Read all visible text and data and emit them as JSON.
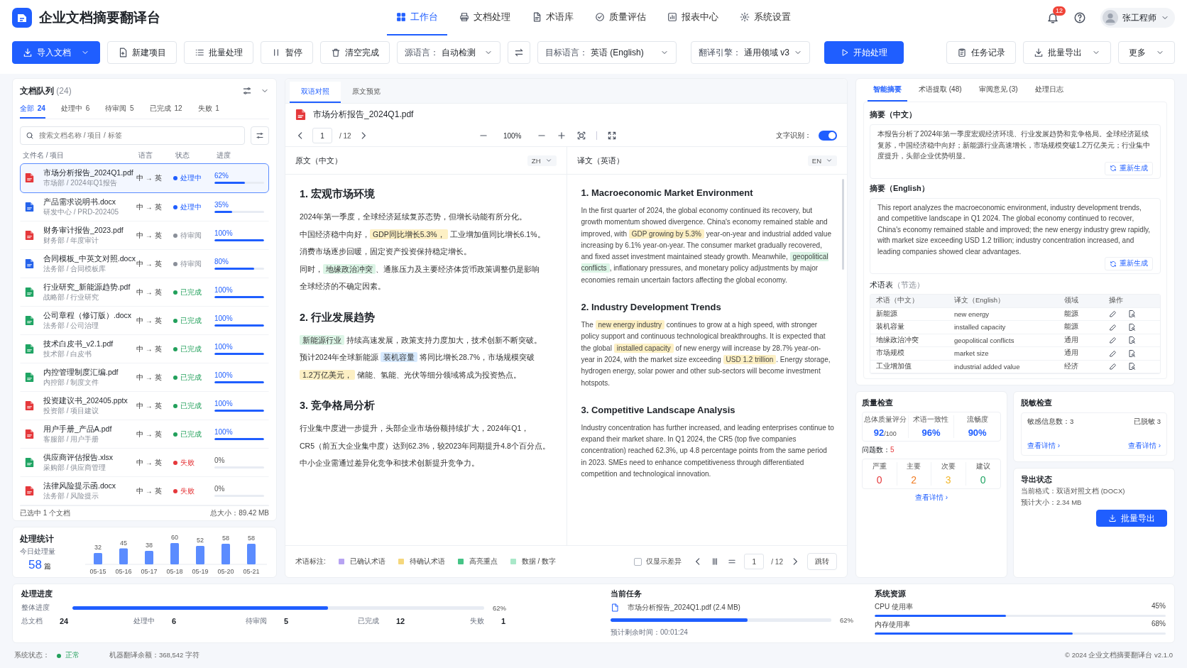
{
  "app": {
    "title": "企业文档摘要翻译台"
  },
  "nav": [
    {
      "label": "工作台",
      "selected": true
    },
    {
      "label": "文档处理",
      "selected": false
    },
    {
      "label": "术语库",
      "selected": false
    },
    {
      "label": "质量评估",
      "selected": false
    },
    {
      "label": "报表中心",
      "selected": false
    },
    {
      "label": "系统设置",
      "selected": false
    }
  ],
  "notifications": {
    "count": "12"
  },
  "user": {
    "name": "张工程师"
  },
  "toolbar": {
    "actions": [
      {
        "label": "导入文档",
        "kind": "primary",
        "dropdown": true
      },
      {
        "label": "新建项目",
        "kind": "plain",
        "dropdown": false
      },
      {
        "label": "批量处理",
        "kind": "plain",
        "dropdown": false
      },
      {
        "label": "暂停",
        "kind": "plain",
        "dropdown": false
      },
      {
        "label": "清空完成",
        "kind": "plain",
        "dropdown": false
      }
    ],
    "selects": [
      {
        "label": "源语言：",
        "value": "自动检测"
      },
      {
        "label": "目标语言：",
        "value": "英语 (English)"
      },
      {
        "label": "翻译引擎：",
        "value": "通用领域 v3"
      }
    ],
    "start": "开始处理",
    "right": [
      {
        "label": "任务记录",
        "kind": "plain",
        "dropdown": false
      },
      {
        "label": "批量导出",
        "kind": "plain",
        "dropdown": true
      },
      {
        "label": "更多",
        "kind": "plain",
        "dropdown": true
      }
    ]
  },
  "queue": {
    "title": "文档队列",
    "count": "(24)",
    "filters": [
      {
        "label": "全部",
        "count": "24",
        "selected": true
      },
      {
        "label": "处理中",
        "count": "6",
        "selected": false
      },
      {
        "label": "待审阅",
        "count": "5",
        "selected": false
      },
      {
        "label": "已完成",
        "count": "12",
        "selected": false
      },
      {
        "label": "失败",
        "count": "1",
        "selected": false
      }
    ],
    "search_placeholder": "搜索文档名称 / 项目 / 标签",
    "columns": [
      "文件名 / 项目",
      "语言",
      "状态",
      "进度"
    ],
    "docs": [
      {
        "name": "市场分析报告_2024Q1.pdf",
        "meta": "市场部 / 2024年Q1报告",
        "color": "#e5383b",
        "lang": "中 → 英",
        "kind": "processing",
        "status_label": "处理中",
        "progress": "62%",
        "level": 0.62,
        "selected": true
      },
      {
        "name": "产品需求说明书.docx",
        "meta": "研发中心 / PRD-202405",
        "color": "#2563eb",
        "lang": "中 → 英",
        "kind": "processing",
        "status_label": "处理中",
        "progress": "35%",
        "level": 0.35,
        "selected": false
      },
      {
        "name": "财务审计报告_2023.pdf",
        "meta": "财务部 / 年度审计",
        "color": "#e5383b",
        "lang": "中 → 英",
        "kind": "pending",
        "status_label": "待审阅",
        "progress": "100%",
        "level": 1,
        "selected": false
      },
      {
        "name": "合同模板_中英文对照.docx",
        "meta": "法务部 / 合同模板库",
        "color": "#2563eb",
        "lang": "中 → 英",
        "kind": "pending",
        "status_label": "待审阅",
        "progress": "80%",
        "level": 0.8,
        "selected": false
      },
      {
        "name": "行业研究_新能源趋势.pdf",
        "meta": "战略部 / 行业研究",
        "color": "#1fa463",
        "lang": "中 → 英",
        "kind": "done",
        "status_label": "已完成",
        "progress": "100%",
        "level": 1,
        "selected": false
      },
      {
        "name": "公司章程（修订版）.docx",
        "meta": "法务部 / 公司治理",
        "color": "#1fa463",
        "lang": "中 → 英",
        "kind": "done",
        "status_label": "已完成",
        "progress": "100%",
        "level": 1,
        "selected": false
      },
      {
        "name": "技术白皮书_v2.1.pdf",
        "meta": "技术部 / 白皮书",
        "color": "#1fa463",
        "lang": "中 → 英",
        "kind": "done",
        "status_label": "已完成",
        "progress": "100%",
        "level": 1,
        "selected": false
      },
      {
        "name": "内控管理制度汇编.pdf",
        "meta": "内控部 / 制度文件",
        "color": "#1fa463",
        "lang": "中 → 英",
        "kind": "done",
        "status_label": "已完成",
        "progress": "100%",
        "level": 1,
        "selected": false
      },
      {
        "name": "投资建议书_202405.pptx",
        "meta": "投资部 / 项目建议",
        "color": "#e5383b",
        "lang": "中 → 英",
        "kind": "done",
        "status_label": "已完成",
        "progress": "100%",
        "level": 1,
        "selected": false
      },
      {
        "name": "用户手册_产品A.pdf",
        "meta": "客服部 / 用户手册",
        "color": "#e5383b",
        "lang": "中 → 英",
        "kind": "done",
        "status_label": "已完成",
        "progress": "100%",
        "level": 1,
        "selected": false
      },
      {
        "name": "供应商评估报告.xlsx",
        "meta": "采购部 / 供应商管理",
        "color": "#1fa463",
        "lang": "中 → 英",
        "kind": "failed",
        "status_label": "失败",
        "progress": "0%",
        "level": 0,
        "selected": false
      },
      {
        "name": "法律风险提示函.docx",
        "meta": "法务部 / 风险提示",
        "color": "#e5383b",
        "lang": "中 → 英",
        "kind": "failed",
        "status_label": "失败",
        "progress": "0%",
        "level": 0,
        "selected": false
      }
    ],
    "selection": "已选中 1 个文档",
    "total": "总大小：89.42 MB"
  },
  "stats": {
    "title": "处理统计",
    "today_label": "今日处理量",
    "today_value": "58",
    "today_unit": "篇",
    "chart_data": {
      "type": "bar",
      "categories": [
        "05-15",
        "05-16",
        "05-17",
        "05-18",
        "05-19",
        "05-20",
        "05-21"
      ],
      "values": [
        32,
        45,
        38,
        60,
        52,
        58,
        58
      ],
      "data_labels": true
    }
  },
  "viewer": {
    "tabs": [
      {
        "label": "双语对照",
        "selected": true
      },
      {
        "label": "原文预览",
        "selected": false
      }
    ],
    "file": "市场分析报告_2024Q1.pdf",
    "page": "1",
    "total": "/ 12",
    "zoom": "100%",
    "ocr": {
      "label": "文字识别：",
      "on": true
    },
    "source": {
      "title": "原文（中文）",
      "lang": "ZH",
      "sections": [
        {
          "heading": "1.  宏观市场环境",
          "lines": [
            [
              {
                "text": "2024年第一季度，全球经济延续复苏态势，但增长动能有所分化。"
              }
            ],
            [
              {
                "text": "中国经济稳中向好，"
              },
              {
                "text": "GDP同比增长5.3%，",
                "kind": "pending"
              },
              {
                "text": " 工业增加值同比增长6.1%。"
              }
            ],
            [
              {
                "text": "消费市场逐步回暖，固定资产投资保持稳定增长。"
              }
            ],
            [
              {
                "text": "同时，"
              },
              {
                "text": "地缘政治冲突",
                "kind": "key"
              },
              {
                "text": "、通胀压力及主要经济体货币政策调整仍是影响"
              }
            ],
            [
              {
                "text": "全球经济的不确定因素。"
              }
            ]
          ]
        },
        {
          "heading": "2. 行业发展趋势",
          "lines": [
            [
              {
                "text": "新能源行业",
                "kind": "key"
              },
              {
                "text": " 持续高速发展，政策支持力度加大，技术创新不断突破。"
              }
            ],
            [
              {
                "text": "预计2024年全球新能源 "
              },
              {
                "text": "装机容量",
                "kind": "confirmed"
              },
              {
                "text": " 将同比增长28.7%，市场规模突破"
              }
            ],
            [
              {
                "text": "1.2万亿美元，",
                "kind": "pending"
              },
              {
                "text": " 储能、氢能、光伏等细分领域将成为投资热点。"
              }
            ]
          ]
        },
        {
          "heading": "3. 竞争格局分析",
          "lines": [
            [
              {
                "text": "行业集中度进一步提升，头部企业市场份额持续扩大，2024年Q1，"
              }
            ],
            [
              {
                "text": "CR5（前五大企业集中度）达到62.3%，较2023年同期提升4.8个百分点。"
              }
            ],
            [
              {
                "text": "中小企业需通过差异化竞争和技术创新提升竞争力。"
              }
            ]
          ]
        }
      ]
    },
    "target": {
      "title": "译文（英语）",
      "lang": "EN",
      "sections": [
        {
          "heading": "1. Macroeconomic Market Environment",
          "segments": [
            {
              "text": "In the first quarter of 2024, the global economy continued its recovery, but growth momentum showed divergence. China's economy remained stable and improved, with "
            },
            {
              "text": "GDP growing by 5.3%",
              "kind": "pending"
            },
            {
              "text": " year-on-year and industrial added value increasing by 6.1% year-on-year. The consumer market gradually recovered, and fixed asset investment maintained steady growth. Meanwhile, "
            },
            {
              "text": "geopolitical conflicts",
              "kind": "key"
            },
            {
              "text": ", inflationary pressures, and monetary policy adjustments by major economies remain uncertain factors affecting the global economy."
            }
          ]
        },
        {
          "heading": "2. Industry Development Trends",
          "segments": [
            {
              "text": "The "
            },
            {
              "text": "new energy industry",
              "kind": "pending"
            },
            {
              "text": " continues to grow at a high speed, with stronger policy support and continuous technological breakthroughs. It is expected that the global "
            },
            {
              "text": "installed capacity",
              "kind": "pending"
            },
            {
              "text": " of new energy will increase by 28.7% year-on-year in 2024, with the market size exceeding "
            },
            {
              "text": "USD 1.2 trillion",
              "kind": "pending"
            },
            {
              "text": ". Energy storage, hydrogen energy, solar power and other sub-sectors will become investment hotspots."
            }
          ]
        },
        {
          "heading": "3. Competitive Landscape Analysis",
          "segments": [
            {
              "text": "Industry concentration has further increased, and leading enterprises continue to expand their market share. In Q1 2024, the CR5 (top five companies concentration) reached 62.3%, up 4.8 percentage points from the same period in 2023. SMEs need to enhance competitiveness through differentiated competition and technological innovation."
            }
          ]
        }
      ]
    },
    "legend": {
      "title": "术语标注:",
      "items": [
        {
          "label": "已确认术语",
          "color": "#b7a3f2"
        },
        {
          "label": "待确认术语",
          "color": "#f5d77c"
        },
        {
          "label": "高亮重点",
          "color": "#45c486"
        },
        {
          "label": "数据 / 数字",
          "color": "#a9e8c9"
        }
      ]
    },
    "diff": {
      "label": "仅显示差异",
      "checked": false
    },
    "pager": {
      "page": "1",
      "total": "/ 12",
      "jump": "跳转"
    }
  },
  "insights": {
    "tabs": [
      {
        "label": "智能摘要",
        "selected": true
      },
      {
        "label": "术语提取 (48)",
        "selected": false
      },
      {
        "label": "审阅意见 (3)",
        "selected": false
      },
      {
        "label": "处理日志",
        "selected": false
      }
    ],
    "summary_zh": {
      "title": "摘要（中文）",
      "text": "本报告分析了2024年第一季度宏观经济环境、行业发展趋势和竞争格局。全球经济延续复苏，中国经济稳中向好；新能源行业高速增长，市场规模突破1.2万亿美元；行业集中度提升，头部企业优势明显。",
      "action": "重新生成"
    },
    "summary_en": {
      "title": "摘要（English）",
      "text": "This report analyzes the macroeconomic environment, industry development trends, and competitive landscape in Q1 2024. The global economy continued to recover, China's economy remained stable and improved; the new energy industry grew rapidly, with market size exceeding USD 1.2 trillion; industry concentration increased, and leading companies showed clear advantages.",
      "action": "重新生成"
    },
    "glossary": {
      "title": "术语表",
      "note": "（节选）",
      "columns": [
        "术语（中文）",
        "译文（English）",
        "领域",
        "操作"
      ],
      "rows": [
        [
          "新能源",
          "new energy",
          "能源"
        ],
        [
          "装机容量",
          "installed capacity",
          "能源"
        ],
        [
          "地缘政治冲突",
          "geopolitical conflicts",
          "通用"
        ],
        [
          "市场规模",
          "market size",
          "通用"
        ],
        [
          "工业增加值",
          "industrial added value",
          "经济"
        ]
      ]
    }
  },
  "quality": {
    "title": "质量检查",
    "metrics": [
      {
        "label": "总体质量评分",
        "value": "92",
        "suffix": "/100"
      },
      {
        "label": "术语一致性",
        "value": "96%"
      },
      {
        "label": "流畅度",
        "value": "90%"
      }
    ],
    "issues_label": "问题数：",
    "issues": "5",
    "severities": [
      {
        "label": "严重",
        "value": "0",
        "color": "#e5383b"
      },
      {
        "label": "主要",
        "value": "2",
        "color": "#f07b22"
      },
      {
        "label": "次要",
        "value": "3",
        "color": "#f2b72c"
      },
      {
        "label": "建议",
        "value": "0",
        "color": "#1fa463"
      }
    ],
    "link": "查看详情 ›"
  },
  "desensitize": {
    "title": "脱敏检查",
    "items": [
      {
        "text": "敏感信息数：3",
        "link": "查看详情 ›"
      },
      {
        "text": "已脱敏 3",
        "link": "查看详情 ›"
      }
    ]
  },
  "export": {
    "title": "导出状态",
    "format": "当前格式：双语对照文档 (DOCX)",
    "size": "预计大小：2.34 MB",
    "action": "批量导出"
  },
  "progress": {
    "title": "处理进度",
    "subtitle": "整体进度",
    "level": 0.62,
    "percent": "62%",
    "stats": [
      {
        "label": "总文档",
        "value": "24"
      },
      {
        "label": "处理中",
        "value": "6"
      },
      {
        "label": "待审阅",
        "value": "5"
      },
      {
        "label": "已完成",
        "value": "12"
      },
      {
        "label": "失败",
        "value": "1"
      }
    ]
  },
  "current_task": {
    "title": "当前任务",
    "file": "市场分析报告_2024Q1.pdf (2.4 MB)",
    "level": 0.62,
    "percent": "62%",
    "eta": "预计剩余时间：00:01:24"
  },
  "resources": {
    "title": "系统资源",
    "items": [
      {
        "label": "CPU 使用率",
        "value": "45%",
        "level": 0.45
      },
      {
        "label": "内存使用率",
        "value": "68%",
        "level": 0.68
      }
    ]
  },
  "footer": {
    "status_label": "系统状态：",
    "status": "正常",
    "status_ok": true,
    "balance": "机器翻译余额：368,542 字符",
    "copyright": "© 2024 企业文档摘要翻译台 v2.1.0"
  }
}
